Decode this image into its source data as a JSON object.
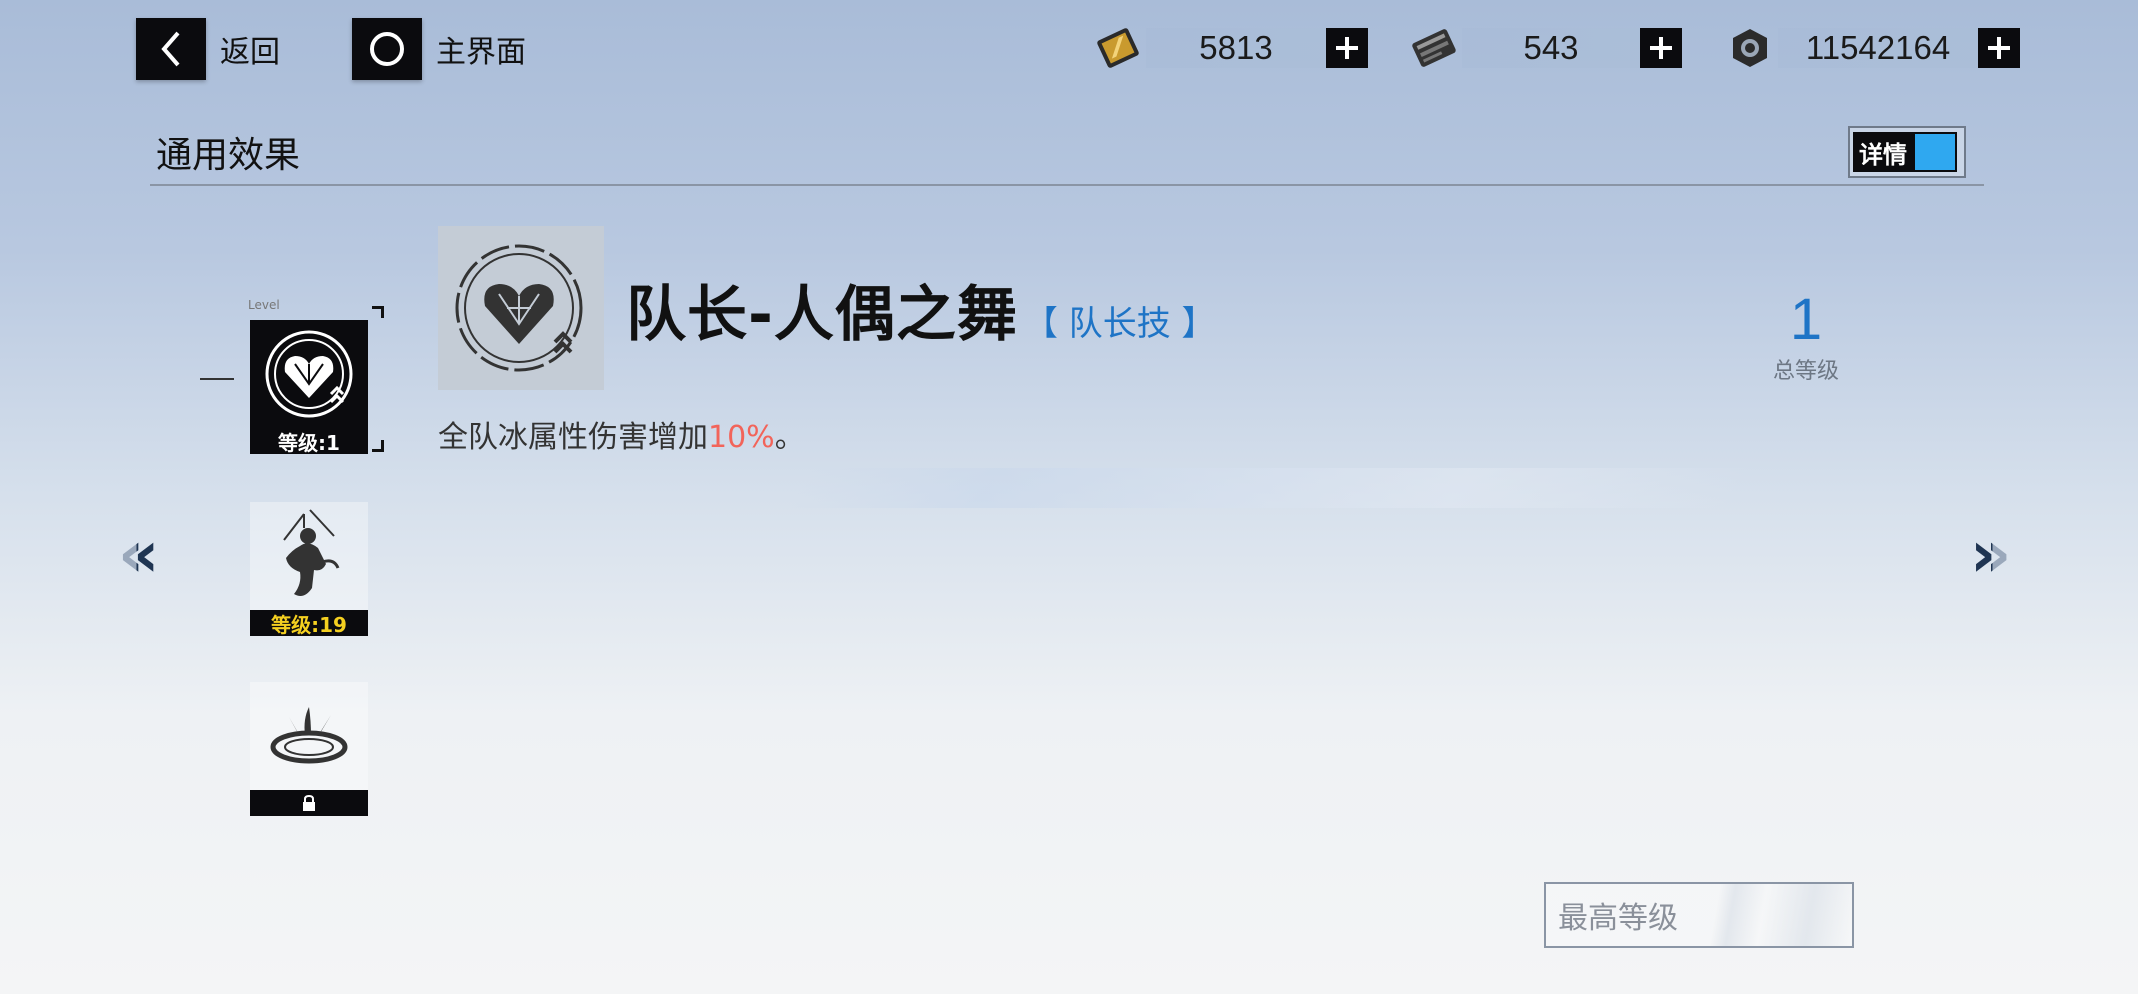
{
  "nav": {
    "back_label": "返回",
    "home_label": "主界面"
  },
  "currencies": [
    {
      "icon": "gold-card-icon",
      "value": "5813"
    },
    {
      "icon": "black-card-icon",
      "value": "543"
    },
    {
      "icon": "hex-nut-icon",
      "value": "11542164"
    }
  ],
  "section": {
    "title": "通用效果",
    "detail_label": "详情"
  },
  "skill_list": [
    {
      "level_text": "等级:1",
      "top_caption": "Level",
      "icon": "heart-crystal-icon"
    },
    {
      "level_text": "等级:19",
      "icon": "puppet-dancer-icon"
    },
    {
      "level_text": "",
      "icon": "ring-sprout-icon",
      "locked": true
    }
  ],
  "skill": {
    "name": "队长-人偶之舞",
    "type": "【 队长技 】",
    "desc_prefix": "全队冰属性伤害增加",
    "desc_highlight": "10%",
    "desc_suffix": "。"
  },
  "total": {
    "value": "1",
    "label": "总等级"
  },
  "arrows": {
    "left": "«",
    "right": "»"
  },
  "max_level_label": "最高等级",
  "colors": {
    "accent_blue": "#1e74c6",
    "highlight_red": "#f2645a",
    "toggle_blue": "#2fa8f0"
  }
}
